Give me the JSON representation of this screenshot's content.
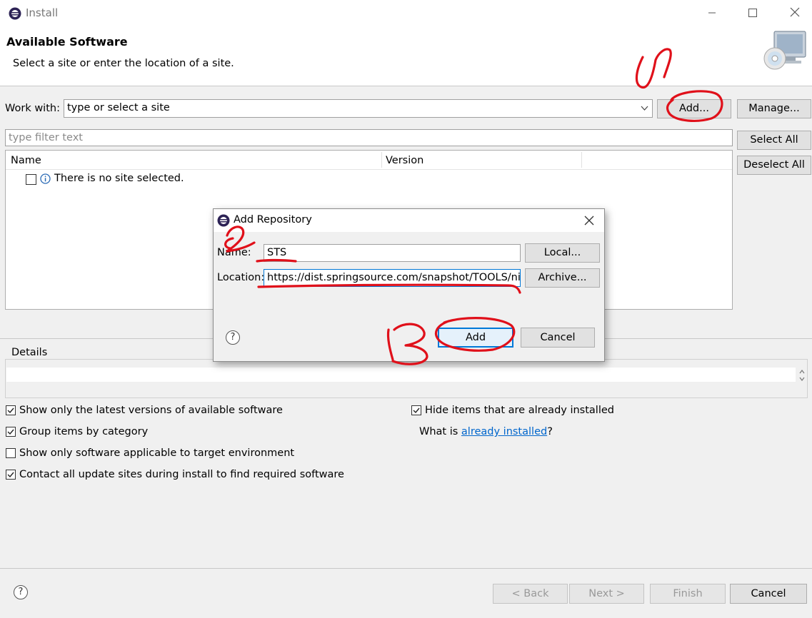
{
  "window": {
    "title": "Install",
    "controls": [
      "minimize-icon",
      "maximize-icon",
      "close-icon"
    ]
  },
  "header": {
    "title": "Available Software",
    "subtitle": "Select a site or enter the location of a site."
  },
  "work_with": {
    "label": "Work with:",
    "value": "type or select a site",
    "add_label": "Add...",
    "manage_label": "Manage..."
  },
  "filter": {
    "placeholder": "type filter text"
  },
  "side_buttons": {
    "select_all": "Select All",
    "deselect_all": "Deselect All"
  },
  "tree": {
    "columns": [
      "Name",
      "Version"
    ],
    "message": "There is no site selected."
  },
  "details": {
    "label": "Details"
  },
  "options": {
    "latest_versions": {
      "label": "Show only the latest versions of available software",
      "checked": true
    },
    "group_by_category": {
      "label": "Group items by category",
      "checked": true
    },
    "target_env": {
      "label": "Show only software applicable to target environment",
      "checked": false
    },
    "contact_sites": {
      "label": "Contact all update sites during install to find required software",
      "checked": true
    },
    "hide_installed": {
      "label": "Hide items that are already installed",
      "checked": true
    },
    "what_is_prefix": "What is ",
    "what_is_link": "already installed",
    "what_is_suffix": "?"
  },
  "footer": {
    "back": "< Back",
    "next": "Next >",
    "finish": "Finish",
    "cancel": "Cancel"
  },
  "dialog": {
    "title": "Add Repository",
    "name_label": "Name:",
    "name_value": "STS",
    "location_label": "Location:",
    "location_value": "https://dist.springsource.com/snapshot/TOOLS/nightly",
    "local_label": "Local...",
    "archive_label": "Archive...",
    "add_label": "Add",
    "cancel_label": "Cancel"
  },
  "annotations": [
    "1",
    "2",
    "3"
  ],
  "colors": {
    "annotation": "#e0101a",
    "link": "#0066cc",
    "focus": "#0078d7"
  }
}
